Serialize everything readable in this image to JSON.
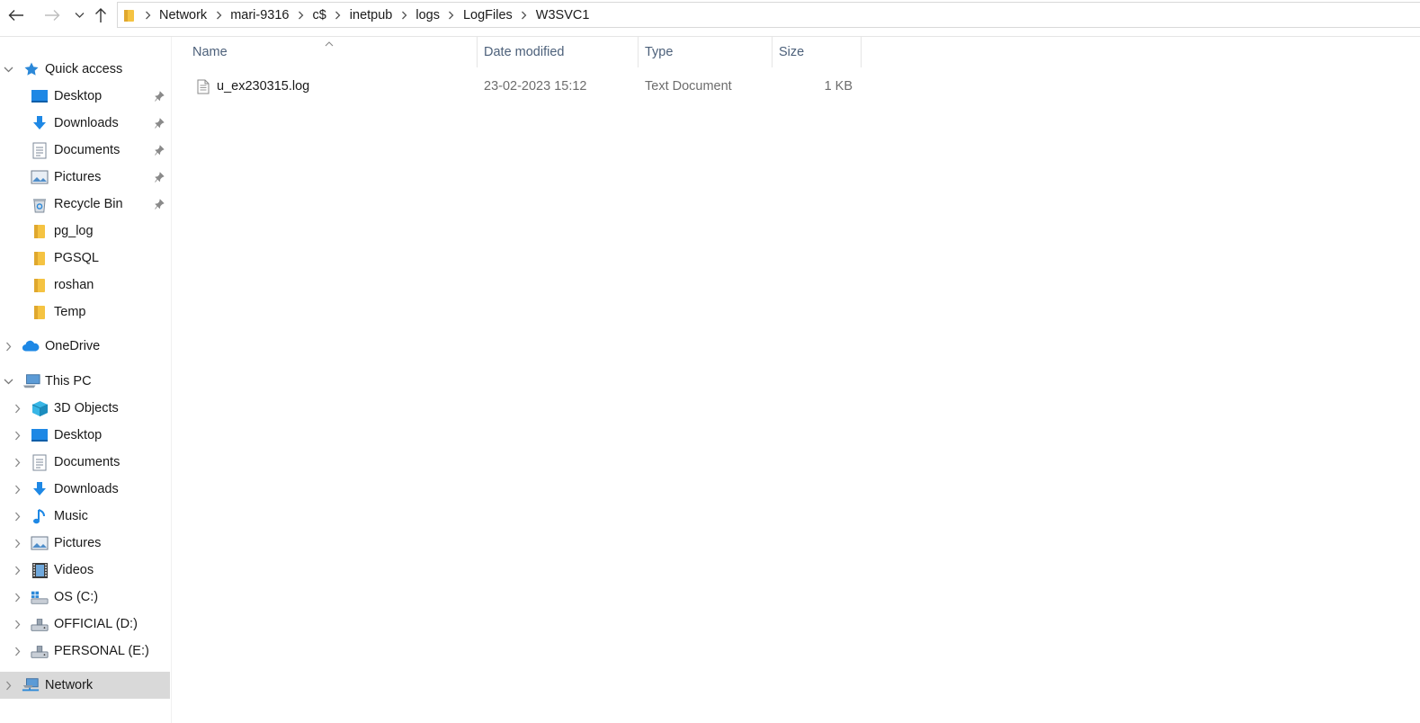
{
  "toolbar": {
    "back_icon": "arrow-left-icon",
    "forward_icon": "arrow-right-icon",
    "recent_icon": "chevron-down-icon",
    "up_icon": "arrow-up-icon"
  },
  "address": {
    "folder_icon": "folder-icon",
    "crumbs": [
      "Network",
      "mari-9316",
      "c$",
      "inetpub",
      "logs",
      "LogFiles",
      "W3SVC1"
    ]
  },
  "sidebar": {
    "quick_access": {
      "label": "Quick access",
      "icon": "star-icon"
    },
    "quick_items": [
      {
        "label": "Desktop",
        "icon": "desktop-icon",
        "pinned": true
      },
      {
        "label": "Downloads",
        "icon": "downloads-icon",
        "pinned": true
      },
      {
        "label": "Documents",
        "icon": "documents-icon",
        "pinned": true
      },
      {
        "label": "Pictures",
        "icon": "pictures-icon",
        "pinned": true
      },
      {
        "label": "Recycle Bin",
        "icon": "recycle-bin-icon",
        "pinned": true
      },
      {
        "label": "pg_log",
        "icon": "folder-icon",
        "pinned": false
      },
      {
        "label": "PGSQL",
        "icon": "folder-icon",
        "pinned": false
      },
      {
        "label": "roshan",
        "icon": "folder-icon",
        "pinned": false
      },
      {
        "label": "Temp",
        "icon": "folder-icon",
        "pinned": false
      }
    ],
    "onedrive": {
      "label": "OneDrive",
      "icon": "cloud-icon"
    },
    "this_pc": {
      "label": "This PC",
      "icon": "computer-icon"
    },
    "pc_items": [
      {
        "label": "3D Objects",
        "icon": "cube-icon"
      },
      {
        "label": "Desktop",
        "icon": "desktop-icon"
      },
      {
        "label": "Documents",
        "icon": "documents-icon"
      },
      {
        "label": "Downloads",
        "icon": "downloads-icon"
      },
      {
        "label": "Music",
        "icon": "music-icon"
      },
      {
        "label": "Pictures",
        "icon": "pictures-icon"
      },
      {
        "label": "Videos",
        "icon": "videos-icon"
      },
      {
        "label": "OS (C:)",
        "icon": "windows-drive-icon"
      },
      {
        "label": "OFFICIAL (D:)",
        "icon": "drive-icon"
      },
      {
        "label": "PERSONAL (E:)",
        "icon": "drive-icon"
      }
    ],
    "network": {
      "label": "Network",
      "icon": "network-icon",
      "selected": true
    }
  },
  "filelist": {
    "columns": [
      "Name",
      "Date modified",
      "Type",
      "Size"
    ],
    "sort_column": "Name",
    "files": [
      {
        "name": "u_ex230315.log",
        "date": "23-02-2023 15:12",
        "type": "Text Document",
        "size": "1 KB",
        "icon": "text-file-icon"
      }
    ]
  },
  "colors": {
    "accent_blue": "#1e88e5",
    "folder_yellow": "#f5c342",
    "header_text": "#4c607a",
    "selected_bg": "#d9d9d9"
  }
}
